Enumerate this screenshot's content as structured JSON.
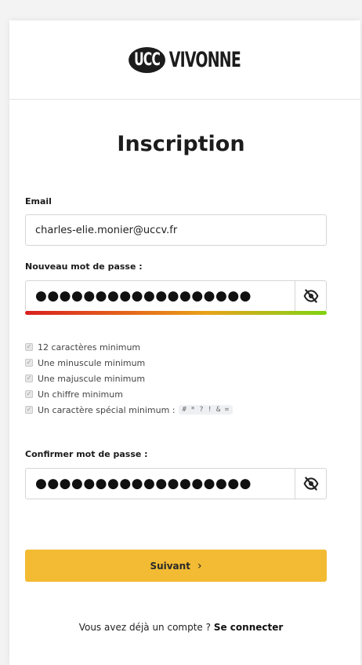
{
  "logo": {
    "mark": "UCC",
    "name": "VIVONNE"
  },
  "form": {
    "title": "Inscription",
    "email_label": "Email",
    "email_value": "charles-elie.monier@uccv.fr",
    "password_label": "Nouveau mot de passe :",
    "password_mask": "●●●●●●●●●●●●●●●●●●",
    "password_strength": 1.0,
    "rules": [
      {
        "label": "12 caractères minimum",
        "checked": true
      },
      {
        "label": "Une minuscule minimum",
        "checked": true
      },
      {
        "label": "Une majuscule minimum",
        "checked": true
      },
      {
        "label": "Un chiffre minimum",
        "checked": true
      },
      {
        "label": "Un caractère spécial minimum :",
        "checked": true
      }
    ],
    "special_chars": "# * ? ! & =",
    "confirm_label": "Confirmer mot de passe :",
    "confirm_mask": "●●●●●●●●●●●●●●●●●●",
    "next_button": "Suivant",
    "next_chevron": "›"
  },
  "footer": {
    "question": "Vous avez déjà un compte ?",
    "link": "Se connecter"
  },
  "icons": {
    "password_toggle": "eye-slash-icon",
    "confirm_toggle": "eye-slash-icon"
  },
  "colors": {
    "accent_button": "#f2bb33",
    "strength_start": "#d81f1f",
    "strength_end": "#7fd20f"
  }
}
